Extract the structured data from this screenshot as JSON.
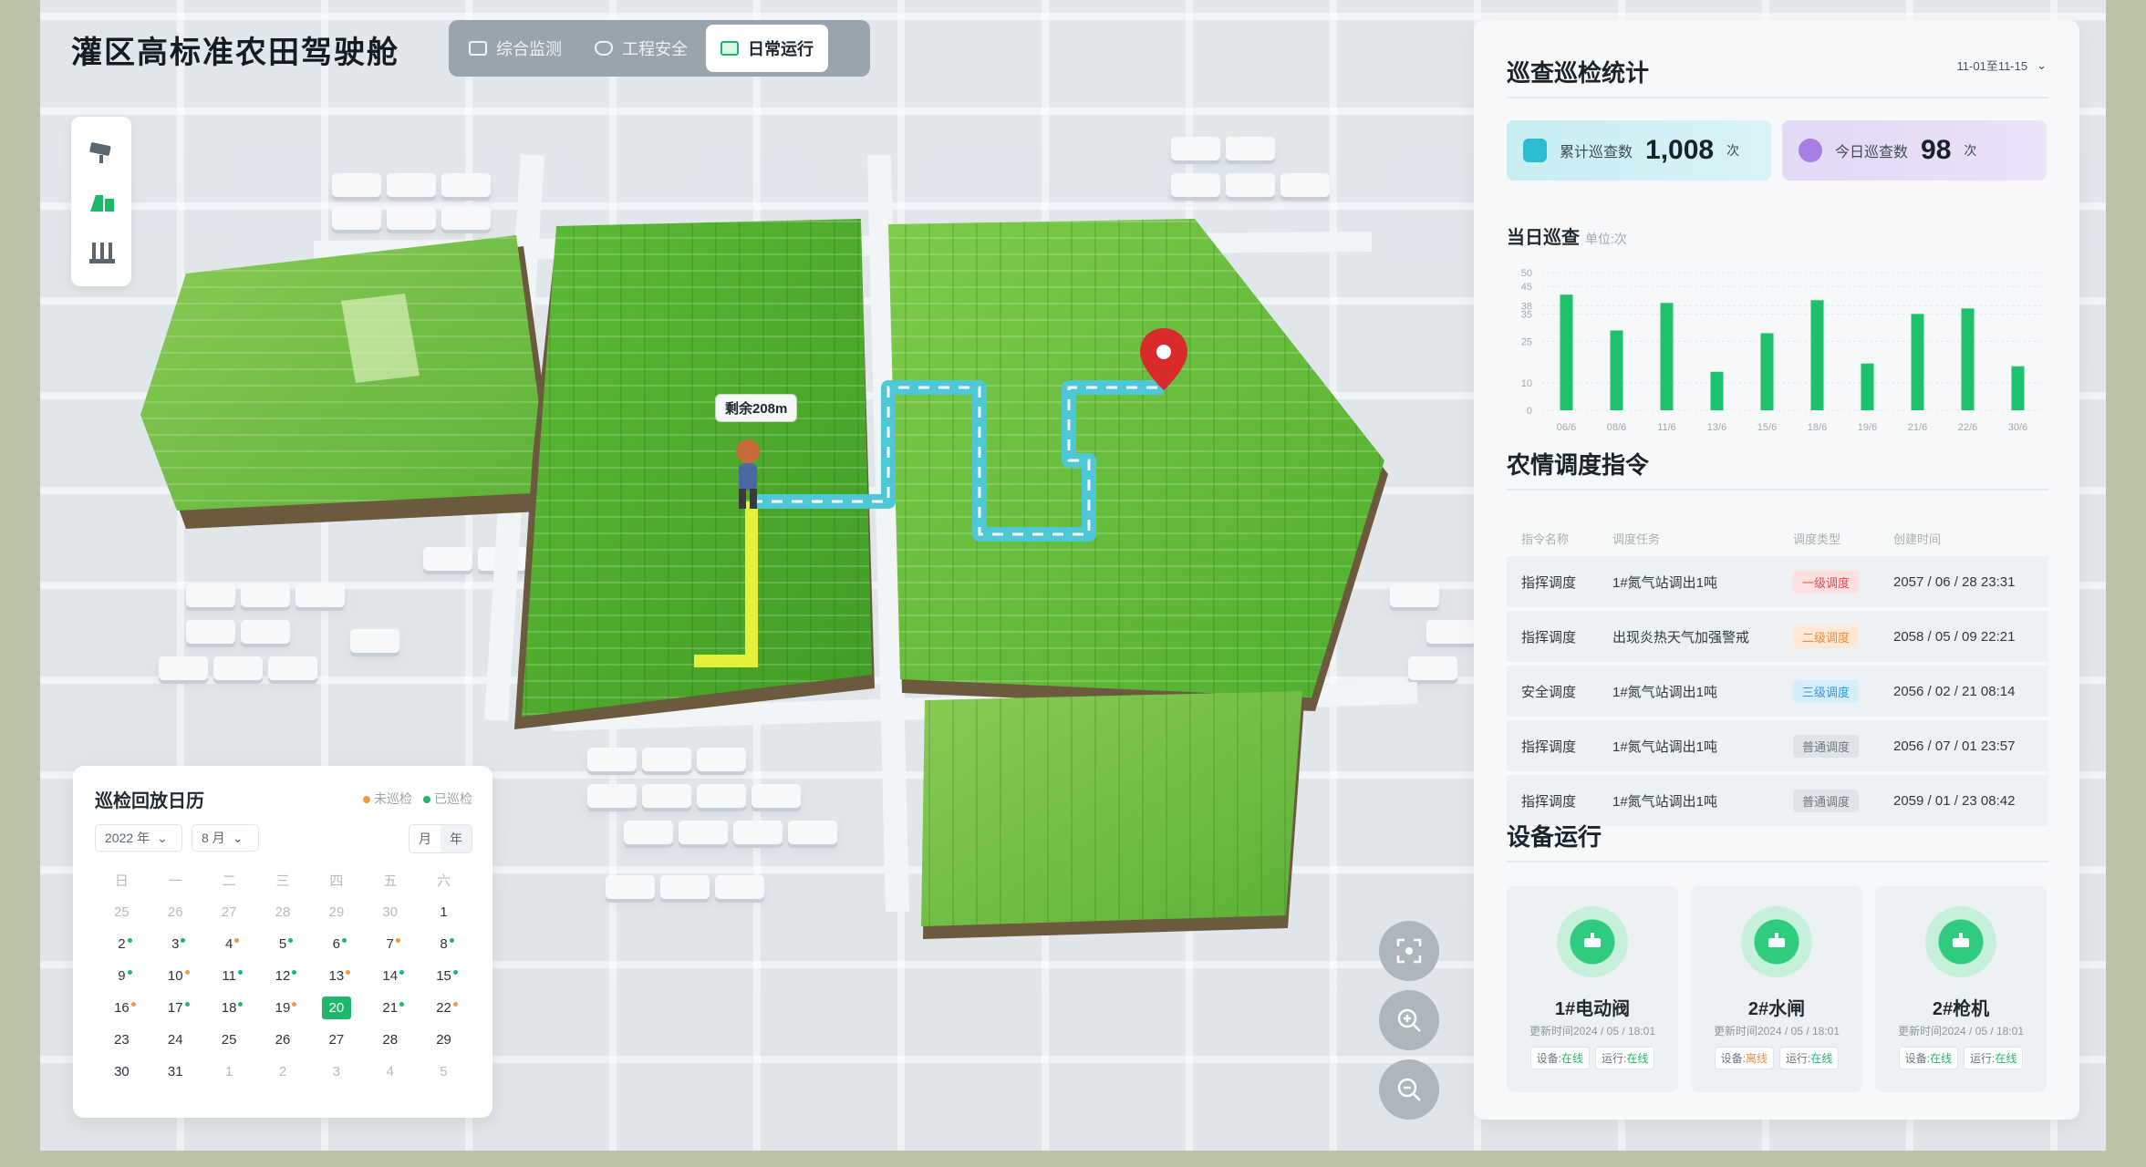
{
  "header": {
    "app_title": "灌区高标准农田驾驶舱",
    "tabs": [
      {
        "label": "综合监测",
        "active": false
      },
      {
        "label": "工程安全",
        "active": false
      },
      {
        "label": "日常运行",
        "active": true
      }
    ]
  },
  "toolbar": {
    "tools": [
      {
        "icon": "camera-icon"
      },
      {
        "icon": "farmland-icon"
      },
      {
        "icon": "facility-icon"
      }
    ]
  },
  "map": {
    "walker_label": "剩余208m",
    "controls": [
      {
        "icon": "locate-icon"
      },
      {
        "icon": "zoom-in-icon"
      },
      {
        "icon": "zoom-out-icon"
      }
    ]
  },
  "calendar": {
    "title": "巡检回放日历",
    "legend": [
      {
        "label": "未巡检",
        "color": "#f29a42"
      },
      {
        "label": "已巡检",
        "color": "#1fb86a"
      }
    ],
    "year_select": "2022 年",
    "month_select": "8 月",
    "view_modes": [
      "月",
      "年"
    ],
    "weekdays": [
      "日",
      "一",
      "二",
      "三",
      "四",
      "五",
      "六"
    ],
    "weeks": [
      [
        "25",
        "26",
        "27",
        "28",
        "29",
        "30",
        "1"
      ],
      [
        "2",
        "3",
        "4",
        "5",
        "6",
        "7",
        "8"
      ],
      [
        "9",
        "10",
        "11",
        "12",
        "13",
        "14",
        "15"
      ],
      [
        "16",
        "17",
        "18",
        "19",
        "20",
        "21",
        "22"
      ],
      [
        "23",
        "24",
        "25",
        "26",
        "27",
        "28",
        "29"
      ],
      [
        "30",
        "31",
        "1",
        "2",
        "3",
        "4",
        "5"
      ]
    ],
    "today": "20"
  },
  "patrol_stats": {
    "title": "巡查巡检统计",
    "date_range": "11-01至11-15",
    "total": {
      "label": "累计巡查数",
      "value": "1,008",
      "unit": "次"
    },
    "today": {
      "label": "今日巡查数",
      "value": "98",
      "unit": "次"
    },
    "daily_title": "当日巡查",
    "daily_unit": "单位:次"
  },
  "chart_data": {
    "type": "bar",
    "title": "当日巡查",
    "categories": [
      "06/6",
      "08/6",
      "11/6",
      "13/6",
      "15/6",
      "18/6",
      "19/6",
      "21/6",
      "22/6",
      "30/6"
    ],
    "values": [
      42,
      29,
      39,
      14,
      28,
      40,
      17,
      35,
      37,
      16
    ],
    "y_ticks": [
      "0",
      "10",
      "25",
      "35",
      "38",
      "45",
      "50"
    ],
    "ylim": [
      0,
      55
    ],
    "bar_color": "#1ec26c",
    "grid": true
  },
  "dispatch": {
    "title": "农情调度指令",
    "columns": [
      "指令名称",
      "调度任务",
      "调度类型",
      "创建时间"
    ],
    "rows": [
      {
        "name": "指挥调度",
        "task": "1#氮气站调出1吨",
        "type": "一级调度",
        "level": "red",
        "time": "2057 / 06 / 28 23:31"
      },
      {
        "name": "指挥调度",
        "task": "出现炎热天气加强警戒",
        "type": "二级调度",
        "level": "orange",
        "time": "2058 / 05 / 09 22:21"
      },
      {
        "name": "安全调度",
        "task": "1#氮气站调出1吨",
        "type": "三级调度",
        "level": "blue",
        "time": "2056 / 02 / 21 08:14"
      },
      {
        "name": "指挥调度",
        "task": "1#氮气站调出1吨",
        "type": "普通调度",
        "level": "gray",
        "time": "2056 / 07 / 01 23:57"
      },
      {
        "name": "指挥调度",
        "task": "1#氮气站调出1吨",
        "type": "普通调度",
        "level": "gray",
        "time": "2059 / 01 / 23 08:42"
      }
    ]
  },
  "devices": {
    "title": "设备运行",
    "items": [
      {
        "name": "1#电动阀",
        "icon": "valve-icon",
        "time": "更新时间2024 / 05 / 18:01",
        "device_status": "在线",
        "run_status": "在线"
      },
      {
        "name": "2#水闸",
        "icon": "sluice-icon",
        "time": "更新时间2024 / 05 / 18:01",
        "device_status": "离线",
        "run_status": "在线"
      },
      {
        "name": "2#枪机",
        "icon": "gun-camera-icon",
        "time": "更新时间2024 / 05 / 18:01",
        "device_status": "在线",
        "run_status": "在线"
      }
    ],
    "device_label": "设备:",
    "run_label": "运行:"
  }
}
